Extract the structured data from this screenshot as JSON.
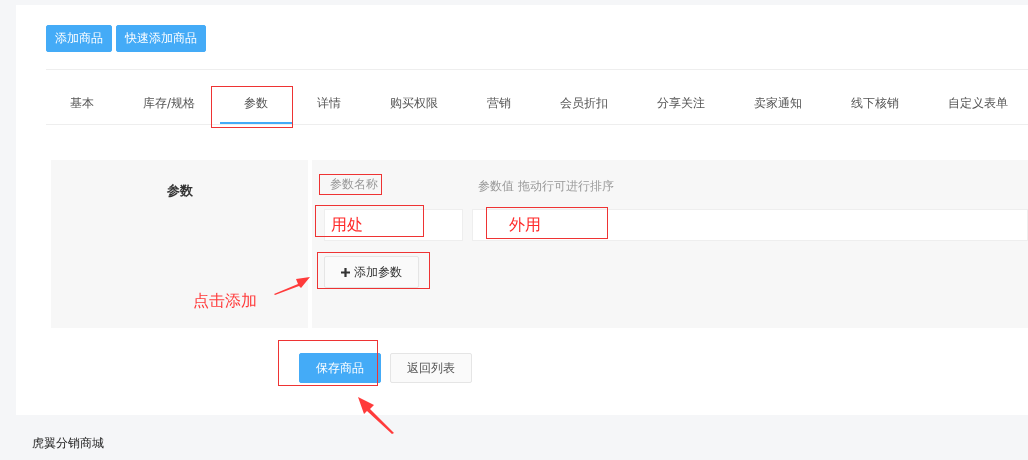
{
  "toolbar": {
    "buttons": [
      "添加商品",
      "快速添加商品"
    ]
  },
  "tabs": [
    {
      "label": "基本",
      "selected": false
    },
    {
      "label": "库存/规格",
      "selected": false
    },
    {
      "label": "参数",
      "selected": true
    },
    {
      "label": "详情",
      "selected": false
    },
    {
      "label": "购买权限",
      "selected": false
    },
    {
      "label": "营销",
      "selected": false
    },
    {
      "label": "会员折扣",
      "selected": false
    },
    {
      "label": "分享关注",
      "selected": false
    },
    {
      "label": "卖家通知",
      "selected": false
    },
    {
      "label": "线下核销",
      "selected": false
    },
    {
      "label": "自定义表单",
      "selected": false
    }
  ],
  "params": {
    "label": "参数",
    "name_header": "参数名称",
    "value_header": "参数值 拖动行可进行排序",
    "rows": [
      {
        "name": "用处",
        "value": "外用"
      }
    ],
    "add_button": "添加参数"
  },
  "actions": {
    "save": "保存商品",
    "back": "返回列表"
  },
  "footer": "虎翼分销商城",
  "annotation": "点击添加"
}
